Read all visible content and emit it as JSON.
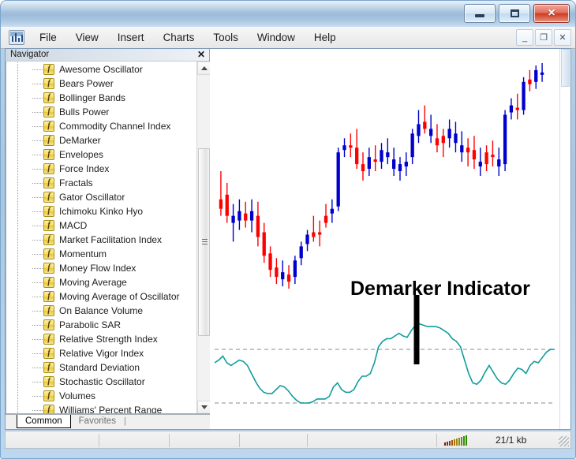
{
  "window": {
    "os_buttons": [
      {
        "name": "minimize",
        "glyph": "minimize-glyph"
      },
      {
        "name": "maximize",
        "glyph": "maximize-glyph"
      },
      {
        "name": "close",
        "glyph": "×"
      }
    ]
  },
  "menubar": {
    "app_icon": "chart-app-icon",
    "items": [
      {
        "label": "File"
      },
      {
        "label": "View"
      },
      {
        "label": "Insert"
      },
      {
        "label": "Charts"
      },
      {
        "label": "Tools"
      },
      {
        "label": "Window"
      },
      {
        "label": "Help"
      }
    ],
    "mdi_buttons": [
      {
        "label": "_",
        "name": "mdi-minimize-button"
      },
      {
        "label": "❐",
        "name": "mdi-restore-button"
      },
      {
        "label": "✕",
        "name": "mdi-close-button"
      }
    ]
  },
  "navigator": {
    "title": "Navigator",
    "close_label": "✕",
    "fx_glyph": "f",
    "items": [
      {
        "label": "Awesome Oscillator"
      },
      {
        "label": "Bears Power"
      },
      {
        "label": "Bollinger Bands"
      },
      {
        "label": "Bulls Power"
      },
      {
        "label": "Commodity Channel Index"
      },
      {
        "label": "DeMarker"
      },
      {
        "label": "Envelopes"
      },
      {
        "label": "Force Index"
      },
      {
        "label": "Fractals"
      },
      {
        "label": "Gator Oscillator"
      },
      {
        "label": "Ichimoku Kinko Hyo"
      },
      {
        "label": "MACD"
      },
      {
        "label": "Market Facilitation Index"
      },
      {
        "label": "Momentum"
      },
      {
        "label": "Money Flow Index"
      },
      {
        "label": "Moving Average"
      },
      {
        "label": "Moving Average of Oscillator"
      },
      {
        "label": "On Balance Volume"
      },
      {
        "label": "Parabolic SAR"
      },
      {
        "label": "Relative Strength Index"
      },
      {
        "label": "Relative Vigor Index"
      },
      {
        "label": "Standard Deviation"
      },
      {
        "label": "Stochastic Oscillator"
      },
      {
        "label": "Volumes"
      },
      {
        "label": "Williams' Percent Range"
      }
    ],
    "tabs": [
      {
        "label": "Common",
        "active": true
      },
      {
        "label": "Favorites",
        "active": false
      }
    ]
  },
  "statusbar": {
    "traffic_label": "traffic-signal-icon",
    "kb_text": "21/1 kb"
  },
  "chart_data": {
    "type": "candlestick",
    "title": "",
    "annotation": "Demarker Indicator",
    "colors": {
      "up_candle": "#0000cd",
      "down_candle": "#ff0000",
      "indicator_line": "#119c9c",
      "level_line": "#b0b0b0",
      "background": "#ffffff",
      "annotation": "#000000"
    },
    "price_panel": {
      "ylim": [
        0,
        1
      ],
      "candles": [
        {
          "o": 0.4,
          "h": 0.52,
          "l": 0.33,
          "c": 0.36,
          "dir": "down"
        },
        {
          "o": 0.42,
          "h": 0.47,
          "l": 0.3,
          "c": 0.33,
          "dir": "down"
        },
        {
          "o": 0.33,
          "h": 0.38,
          "l": 0.22,
          "c": 0.3,
          "dir": "up"
        },
        {
          "o": 0.35,
          "h": 0.4,
          "l": 0.27,
          "c": 0.31,
          "dir": "up"
        },
        {
          "o": 0.34,
          "h": 0.39,
          "l": 0.28,
          "c": 0.31,
          "dir": "down"
        },
        {
          "o": 0.35,
          "h": 0.4,
          "l": 0.26,
          "c": 0.31,
          "dir": "up"
        },
        {
          "o": 0.33,
          "h": 0.39,
          "l": 0.2,
          "c": 0.24,
          "dir": "down"
        },
        {
          "o": 0.26,
          "h": 0.3,
          "l": 0.13,
          "c": 0.16,
          "dir": "down"
        },
        {
          "o": 0.17,
          "h": 0.2,
          "l": 0.07,
          "c": 0.1,
          "dir": "down"
        },
        {
          "o": 0.11,
          "h": 0.15,
          "l": 0.04,
          "c": 0.07,
          "dir": "down"
        },
        {
          "o": 0.09,
          "h": 0.14,
          "l": 0.03,
          "c": 0.06,
          "dir": "up"
        },
        {
          "o": 0.08,
          "h": 0.12,
          "l": 0.02,
          "c": 0.05,
          "dir": "down"
        },
        {
          "o": 0.07,
          "h": 0.16,
          "l": 0.04,
          "c": 0.14,
          "dir": "up"
        },
        {
          "o": 0.15,
          "h": 0.22,
          "l": 0.12,
          "c": 0.2,
          "dir": "up"
        },
        {
          "o": 0.21,
          "h": 0.27,
          "l": 0.18,
          "c": 0.25,
          "dir": "up"
        },
        {
          "o": 0.26,
          "h": 0.33,
          "l": 0.22,
          "c": 0.24,
          "dir": "down"
        },
        {
          "o": 0.25,
          "h": 0.31,
          "l": 0.2,
          "c": 0.26,
          "dir": "down"
        },
        {
          "o": 0.3,
          "h": 0.38,
          "l": 0.28,
          "c": 0.33,
          "dir": "down"
        },
        {
          "o": 0.34,
          "h": 0.4,
          "l": 0.3,
          "c": 0.36,
          "dir": "up"
        },
        {
          "o": 0.37,
          "h": 0.62,
          "l": 0.35,
          "c": 0.6,
          "dir": "up"
        },
        {
          "o": 0.61,
          "h": 0.66,
          "l": 0.58,
          "c": 0.63,
          "dir": "up"
        },
        {
          "o": 0.63,
          "h": 0.68,
          "l": 0.58,
          "c": 0.62,
          "dir": "down"
        },
        {
          "o": 0.62,
          "h": 0.7,
          "l": 0.53,
          "c": 0.55,
          "dir": "down"
        },
        {
          "o": 0.55,
          "h": 0.6,
          "l": 0.48,
          "c": 0.52,
          "dir": "down"
        },
        {
          "o": 0.53,
          "h": 0.62,
          "l": 0.5,
          "c": 0.58,
          "dir": "up"
        },
        {
          "o": 0.57,
          "h": 0.63,
          "l": 0.52,
          "c": 0.56,
          "dir": "down"
        },
        {
          "o": 0.56,
          "h": 0.64,
          "l": 0.53,
          "c": 0.61,
          "dir": "up"
        },
        {
          "o": 0.6,
          "h": 0.66,
          "l": 0.55,
          "c": 0.58,
          "dir": "up"
        },
        {
          "o": 0.57,
          "h": 0.62,
          "l": 0.5,
          "c": 0.53,
          "dir": "up"
        },
        {
          "o": 0.52,
          "h": 0.58,
          "l": 0.48,
          "c": 0.55,
          "dir": "up"
        },
        {
          "o": 0.54,
          "h": 0.6,
          "l": 0.5,
          "c": 0.56,
          "dir": "up"
        },
        {
          "o": 0.58,
          "h": 0.7,
          "l": 0.55,
          "c": 0.68,
          "dir": "up"
        },
        {
          "o": 0.67,
          "h": 0.78,
          "l": 0.64,
          "c": 0.72,
          "dir": "up"
        },
        {
          "o": 0.73,
          "h": 0.8,
          "l": 0.68,
          "c": 0.7,
          "dir": "down"
        },
        {
          "o": 0.7,
          "h": 0.76,
          "l": 0.64,
          "c": 0.67,
          "dir": "up"
        },
        {
          "o": 0.66,
          "h": 0.72,
          "l": 0.6,
          "c": 0.63,
          "dir": "down"
        },
        {
          "o": 0.64,
          "h": 0.7,
          "l": 0.58,
          "c": 0.67,
          "dir": "down"
        },
        {
          "o": 0.66,
          "h": 0.74,
          "l": 0.62,
          "c": 0.7,
          "dir": "up"
        },
        {
          "o": 0.68,
          "h": 0.73,
          "l": 0.6,
          "c": 0.64,
          "dir": "up"
        },
        {
          "o": 0.63,
          "h": 0.69,
          "l": 0.56,
          "c": 0.6,
          "dir": "up"
        },
        {
          "o": 0.6,
          "h": 0.66,
          "l": 0.54,
          "c": 0.62,
          "dir": "down"
        },
        {
          "o": 0.61,
          "h": 0.67,
          "l": 0.53,
          "c": 0.57,
          "dir": "down"
        },
        {
          "o": 0.56,
          "h": 0.62,
          "l": 0.5,
          "c": 0.54,
          "dir": "up"
        },
        {
          "o": 0.55,
          "h": 0.63,
          "l": 0.52,
          "c": 0.6,
          "dir": "down"
        },
        {
          "o": 0.59,
          "h": 0.65,
          "l": 0.54,
          "c": 0.58,
          "dir": "down"
        },
        {
          "o": 0.57,
          "h": 0.62,
          "l": 0.5,
          "c": 0.54,
          "dir": "up"
        },
        {
          "o": 0.55,
          "h": 0.78,
          "l": 0.52,
          "c": 0.76,
          "dir": "up"
        },
        {
          "o": 0.77,
          "h": 0.83,
          "l": 0.74,
          "c": 0.8,
          "dir": "up"
        },
        {
          "o": 0.79,
          "h": 0.85,
          "l": 0.74,
          "c": 0.78,
          "dir": "down"
        },
        {
          "o": 0.78,
          "h": 0.92,
          "l": 0.76,
          "c": 0.9,
          "dir": "up"
        },
        {
          "o": 0.89,
          "h": 0.95,
          "l": 0.86,
          "c": 0.91,
          "dir": "down"
        },
        {
          "o": 0.9,
          "h": 0.97,
          "l": 0.87,
          "c": 0.95,
          "dir": "up"
        },
        {
          "o": 0.94,
          "h": 0.98,
          "l": 0.9,
          "c": 0.93,
          "dir": "up"
        }
      ]
    },
    "indicator_panel": {
      "name": "DeMarker",
      "ylim": [
        0,
        1
      ],
      "levels": [
        0.7,
        0.3
      ],
      "values": [
        0.6,
        0.62,
        0.65,
        0.6,
        0.58,
        0.6,
        0.62,
        0.61,
        0.58,
        0.52,
        0.46,
        0.41,
        0.38,
        0.37,
        0.37,
        0.4,
        0.43,
        0.42,
        0.39,
        0.35,
        0.32,
        0.3,
        0.3,
        0.3,
        0.31,
        0.33,
        0.33,
        0.33,
        0.35,
        0.42,
        0.45,
        0.4,
        0.38,
        0.38,
        0.4,
        0.46,
        0.5,
        0.5,
        0.52,
        0.6,
        0.72,
        0.76,
        0.78,
        0.78,
        0.8,
        0.82,
        0.8,
        0.79,
        0.84,
        0.88,
        0.89,
        0.88,
        0.87,
        0.87,
        0.87,
        0.86,
        0.84,
        0.82,
        0.78,
        0.76,
        0.72,
        0.62,
        0.52,
        0.45,
        0.44,
        0.47,
        0.53,
        0.58,
        0.53,
        0.48,
        0.45,
        0.44,
        0.47,
        0.52,
        0.56,
        0.55,
        0.52,
        0.58,
        0.61,
        0.6,
        0.64,
        0.68,
        0.7,
        0.7
      ]
    }
  }
}
